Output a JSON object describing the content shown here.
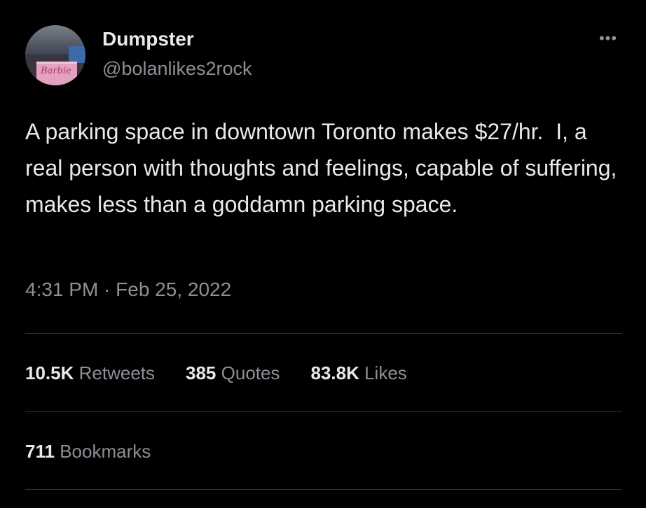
{
  "author": {
    "display_name": "Dumpster",
    "handle": "@bolanlikes2rock",
    "avatar_text": "Barbie"
  },
  "menu": {
    "more_icon": "more-horizontal-icon",
    "more_glyph": "•••"
  },
  "tweet": {
    "text": "A parking space in downtown Toronto makes $27/hr.  I, a real person with thoughts and feelings, capable of suffering, makes less than a goddamn parking space.",
    "timestamp": "4:31 PM · Feb 25, 2022"
  },
  "stats": [
    {
      "value": "10.5K",
      "label": "Retweets"
    },
    {
      "value": "385",
      "label": "Quotes"
    },
    {
      "value": "83.8K",
      "label": "Likes"
    }
  ],
  "bookmarks": {
    "value": "711",
    "label": "Bookmarks"
  },
  "colors": {
    "background": "#000000",
    "text_primary": "#e7e9ea",
    "text_secondary": "#8b9096",
    "divider": "#2f3336"
  }
}
